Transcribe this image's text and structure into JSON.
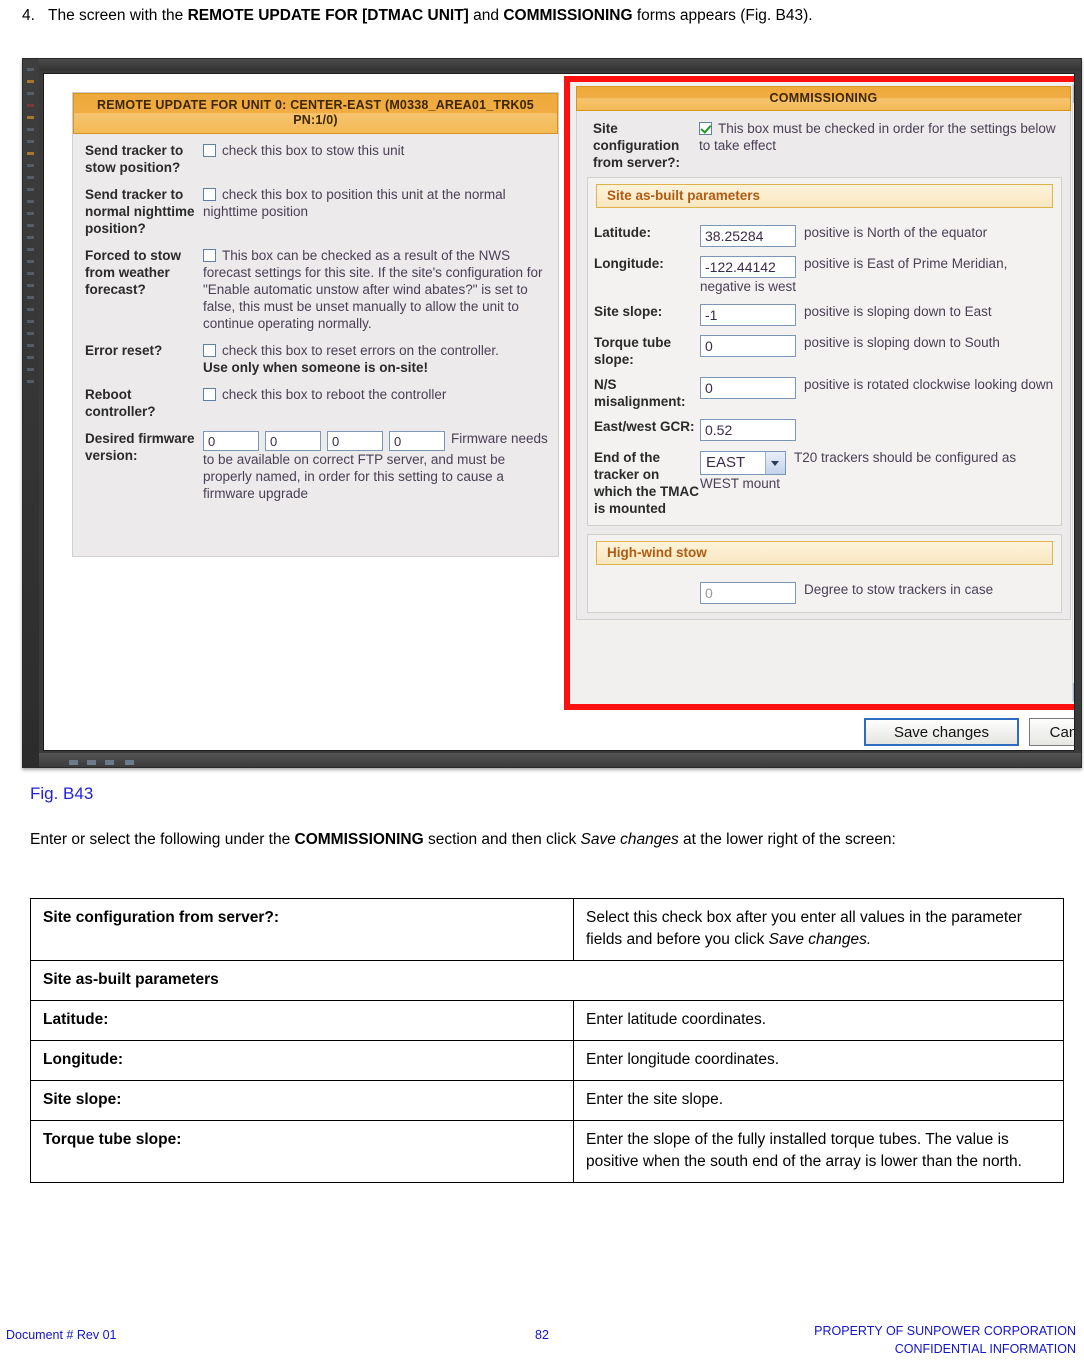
{
  "step": {
    "number": "4.",
    "text_before_b1": "The screen with the ",
    "bold1": "REMOTE UPDATE FOR [DTMAC UNIT]",
    "between": " and ",
    "bold2": "COMMISSIONING",
    "text_after": " forms appears (Fig. B43)."
  },
  "figure": {
    "left_panel": {
      "title": "REMOTE UPDATE FOR UNIT 0: CENTER-EAST (M0338_AREA01_TRK05 PN:1/0)",
      "rows": [
        {
          "label": "Send tracker to stow position?",
          "checkbox": "unchecked",
          "text": "check this box to stow this unit"
        },
        {
          "label": "Send tracker to normal nighttime position?",
          "checkbox": "unchecked",
          "text": "check this box to position this unit at the normal nighttime position"
        },
        {
          "label": "Forced to stow from weather forecast?",
          "checkbox": "unchecked",
          "text": "This box can be checked as a result of the NWS forecast settings for this site. If the site's configuration for \"Enable automatic unstow after wind abates?\" is set to false, this must be unset manually to allow the unit to continue operating normally."
        },
        {
          "label": "Error reset?",
          "checkbox": "unchecked",
          "text": "check this box to reset errors on the controller.",
          "warning": "Use only when someone is on-site!"
        },
        {
          "label": "Reboot controller?",
          "checkbox": "unchecked",
          "text": "check this box to reboot the controller"
        },
        {
          "label": "Desired firmware version:",
          "inputs": [
            "0",
            "0",
            "0",
            "0"
          ],
          "text": "Firmware needs to be available on correct FTP server, and must be properly named, in order for this setting to cause a firmware upgrade"
        }
      ]
    },
    "right_panel": {
      "title": "COMMISSIONING",
      "site_config": {
        "label": "Site configuration from server?:",
        "checkbox": "checked",
        "text": "This box must be checked in order for the settings below to take effect"
      },
      "as_built_header": "Site as-built parameters",
      "as_built_rows": [
        {
          "label": "Latitude:",
          "value": "38.25284",
          "note": "positive is North of the equator"
        },
        {
          "label": "Longitude:",
          "value": "-122.44142",
          "note": "positive is East of Prime Meridian, negative is west"
        },
        {
          "label": "Site slope:",
          "value": "-1",
          "note": "positive is sloping down to East"
        },
        {
          "label": "Torque tube slope:",
          "value": "0",
          "note": "positive is sloping down to South"
        },
        {
          "label": "N/S misalignment:",
          "value": "0",
          "note": "positive is rotated clockwise looking down"
        },
        {
          "label": "East/west GCR:",
          "value": "0.52",
          "note": ""
        },
        {
          "label": "End of the tracker on which the TMAC is mounted",
          "select_value": "EAST",
          "note": "T20 trackers should be configured as WEST mount"
        }
      ],
      "high_wind_header": "High-wind stow",
      "high_wind_row": {
        "value": "0",
        "note": "Degree to stow trackers in case"
      }
    },
    "buttons": {
      "save": "Save changes",
      "cancel": "Cancel"
    },
    "highlight_color": "#ff1010",
    "accent_orange": "#f0ad43"
  },
  "caption": "Fig. B43",
  "lead": {
    "a": "Enter or select the following under the ",
    "bold": "COMMISSIONING",
    "b": " section and then click ",
    "italic": "Save changes",
    "c": " at the lower right of the screen:"
  },
  "table": {
    "rows": [
      {
        "type": "pair",
        "key": "Site configuration from server?:",
        "value_a": "Select this check box after you enter all values in the parameter fields and before you click ",
        "value_italic": "Save changes.",
        "value_b": ""
      },
      {
        "type": "span",
        "key": "Site as-built parameters"
      },
      {
        "type": "pair",
        "key": "Latitude:",
        "value_a": "Enter latitude coordinates.",
        "value_italic": "",
        "value_b": ""
      },
      {
        "type": "pair",
        "key": "Longitude:",
        "value_a": "Enter longitude coordinates.",
        "value_italic": "",
        "value_b": ""
      },
      {
        "type": "pair",
        "key": "Site slope:",
        "value_a": "Enter the site slope.",
        "value_italic": "",
        "value_b": ""
      },
      {
        "type": "pair",
        "key": "Torque tube slope:",
        "value_a": "Enter the slope of the fully installed torque tubes. The value is positive when the south end of the array is lower than the north.",
        "value_italic": "",
        "value_b": ""
      }
    ]
  },
  "footer": {
    "left": "Document #  Rev 01",
    "page": "82",
    "right_line1": "PROPERTY OF SUNPOWER CORPORATION",
    "right_line2": "CONFIDENTIAL INFORMATION"
  }
}
